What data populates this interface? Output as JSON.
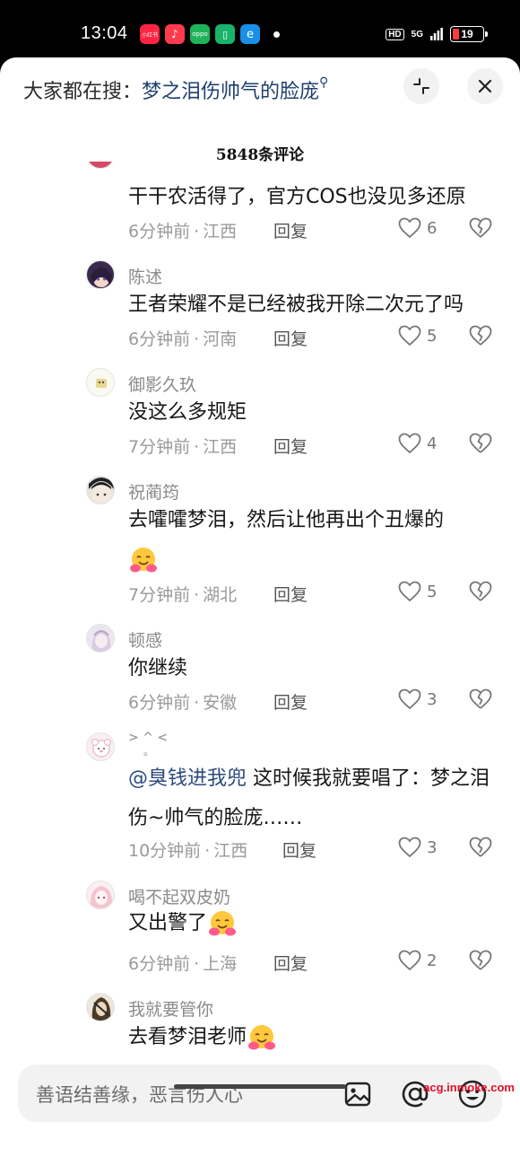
{
  "status_bar": {
    "time": "13:04",
    "app_icons": [
      {
        "name": "app-icon-xiaohongshu",
        "label": "小红书",
        "color": "#ff2442"
      },
      {
        "name": "app-icon-music",
        "label": "♪",
        "color": "#ff3a4f"
      },
      {
        "name": "app-icon-oppo",
        "label": "oppo",
        "color": "#1fb35a"
      },
      {
        "name": "app-icon-green",
        "label": "▯",
        "color": "#19b36b"
      },
      {
        "name": "app-icon-blue",
        "label": "e",
        "color": "#1a8fe8"
      }
    ],
    "hd": "HD",
    "signal": "5G",
    "battery": "19"
  },
  "header": {
    "search_prefix": "大家都在搜：",
    "search_keyword": "梦之泪伤帅气的脸庞"
  },
  "comment_count": "5848条评论",
  "comments": [
    {
      "username": "",
      "text": "干干农活得了，官方COS也没见多还原",
      "time": "6分钟前",
      "location": "江西",
      "reply": "回复",
      "likes": "6",
      "avatar_color": "#d44a6a"
    },
    {
      "username": "陈述",
      "text": "王者荣耀不是已经被我开除二次元了吗",
      "time": "6分钟前",
      "location": "河南",
      "reply": "回复",
      "likes": "5",
      "avatar_color": "#3a2b4e"
    },
    {
      "username": "御影久玖",
      "text": "没这么多规矩",
      "time": "7分钟前",
      "location": "江西",
      "reply": "回复",
      "likes": "4",
      "avatar_color": "#f4f0d8"
    },
    {
      "username": "祝蔺筠",
      "text": "去嚯嚯梦泪，然后让他再出个丑爆的",
      "time": "7分钟前",
      "location": "湖北",
      "reply": "回复",
      "likes": "5",
      "avatar_color": "#2a2a2a"
    },
    {
      "username": "顿感",
      "text": "你继续",
      "time": "6分钟前",
      "location": "安徽",
      "reply": "回复",
      "likes": "3",
      "avatar_color": "#c9b9d6"
    },
    {
      "username": "> ^ <",
      "username2": "。",
      "mention": "@臭钱进我兜",
      "text": "这时候我就要唱了：梦之泪伤~帅气的脸庞……",
      "time": "10分钟前",
      "location": "江西",
      "reply": "回复",
      "likes": "3",
      "avatar_color": "#f6dbe4"
    },
    {
      "username": "喝不起双皮奶",
      "text": "又出警了",
      "time": "6分钟前",
      "location": "上海",
      "reply": "回复",
      "likes": "2",
      "avatar_color": "#f2c6cf"
    },
    {
      "username": "我就要管你",
      "text": "去看梦泪老师",
      "avatar_color": "#5a4630"
    }
  ],
  "input": {
    "placeholder": "善语结善缘，恶言伤人心"
  },
  "watermark": "acg.inmoke.com"
}
